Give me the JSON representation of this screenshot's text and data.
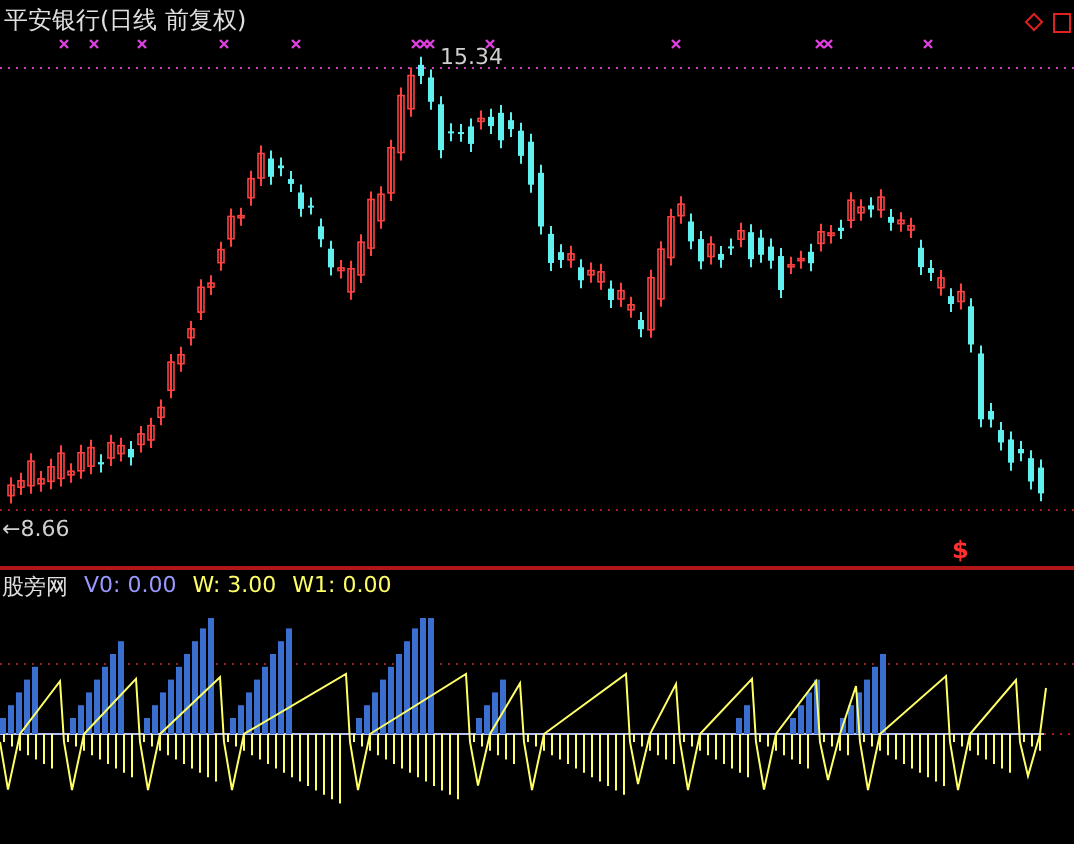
{
  "price_panel": {
    "title": "平安银行(日线 前复权)",
    "high_label": "15.34",
    "low_label": "←8.66",
    "signal_mark": "$"
  },
  "indicator_panel": {
    "name": "股旁网",
    "values": [
      {
        "label": "V0: 0.00",
        "color": "#9999ff"
      },
      {
        "label": "W: 3.00",
        "color": "#ffff66"
      },
      {
        "label": "W1: 0.00",
        "color": "#ffff66"
      }
    ]
  }
}
